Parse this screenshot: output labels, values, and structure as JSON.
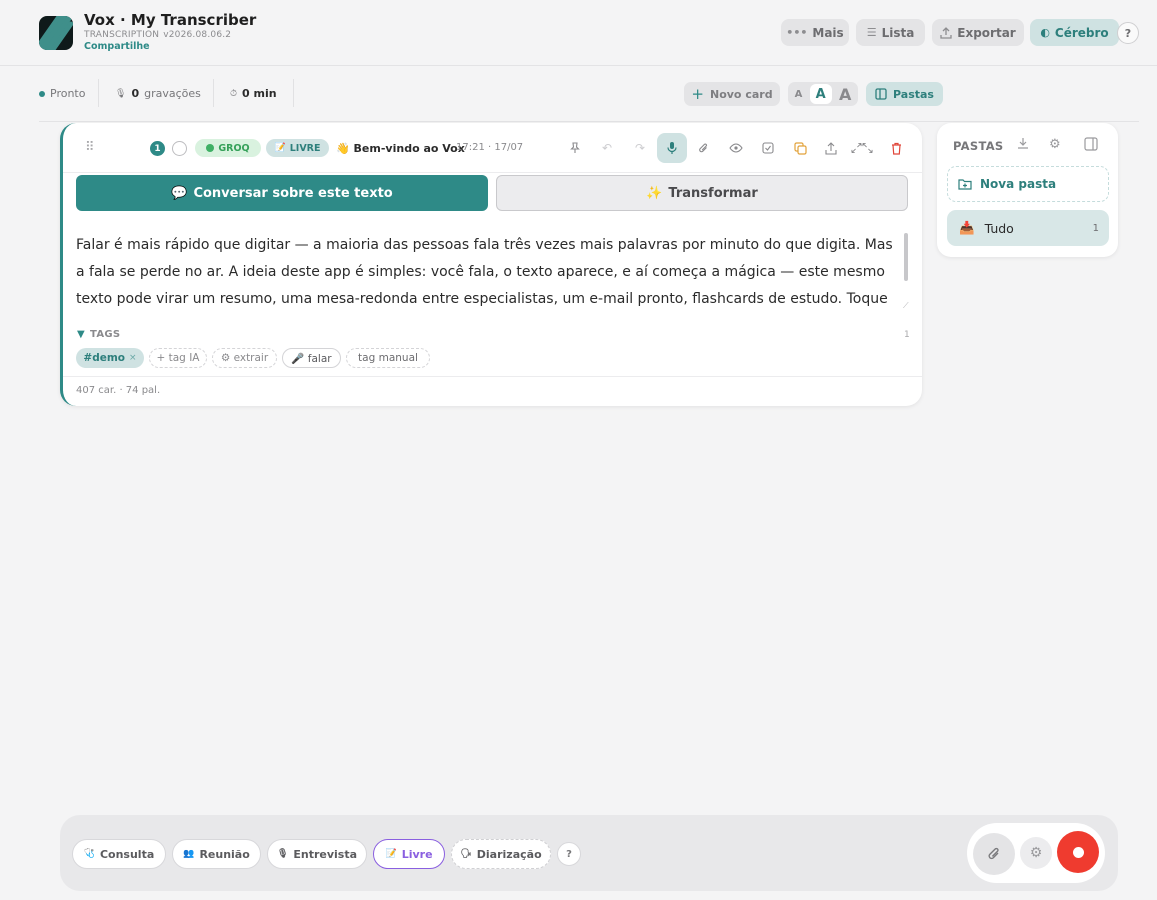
{
  "header": {
    "title": "Vox · My Transcriber",
    "subtitle": "TRANSCRIPTION",
    "version": "v2026.08.06.2",
    "share_label": "Compartilhe",
    "buttons": {
      "more": "Mais",
      "list": "Lista",
      "export": "Exportar",
      "brain": "Cérebro",
      "help": "?"
    }
  },
  "status_bar": {
    "state": "Pronto",
    "recordings_count": "0",
    "recordings_label": "gravações",
    "minutes": "0 min",
    "new_card": "Novo card",
    "font_sizes": [
      "A",
      "A",
      "A"
    ],
    "folders_toggle": "Pastas"
  },
  "card": {
    "number": "1",
    "engine_tag": "GROQ",
    "mode_tag": "LIVRE",
    "title": "Bem-vindo ao Vox",
    "title_emoji": "👋",
    "timestamp": "17:21 · 17/07",
    "chat_button": "Conversar sobre este texto",
    "chat_emoji": "💬",
    "transform_button": "Transformar",
    "transform_emoji": "✨",
    "text": "Falar é mais rápido que digitar — a maioria das pessoas fala três vezes mais palavras por minuto do que digita. Mas a fala se perde no ar. A ideia deste app é simples: você fala, o texto aparece, e aí começa a mágica — este mesmo texto pode virar um resumo, uma mesa-redonda entre especialistas, um e-mail pronto, flashcards de estudo. Toque nos",
    "tags_header": "TAGS",
    "tags_count": "1",
    "tags": {
      "demo": "#demo",
      "demo_remove": "×",
      "ai_tag": "+ tag IA",
      "extract": "⚙ extrair",
      "speak": "🎤 falar",
      "manual": "tag manual"
    },
    "footer": "407 car. · 74 pal."
  },
  "folders": {
    "header": "PASTAS",
    "new_folder": "Nova pasta",
    "all_label": "Tudo",
    "all_count": "1"
  },
  "bottom_bar": {
    "modes": {
      "consulta": "Consulta",
      "reuniao": "Reunião",
      "entrevista": "Entrevista",
      "livre": "Livre",
      "diarizacao": "Diarização"
    },
    "help": "?"
  },
  "colors": {
    "accent": "#2e8a87",
    "accent_light": "#cfe2e2",
    "active_mode": "#8a5fe0",
    "record": "#ef3b2f",
    "groq_green": "#3fb065"
  }
}
